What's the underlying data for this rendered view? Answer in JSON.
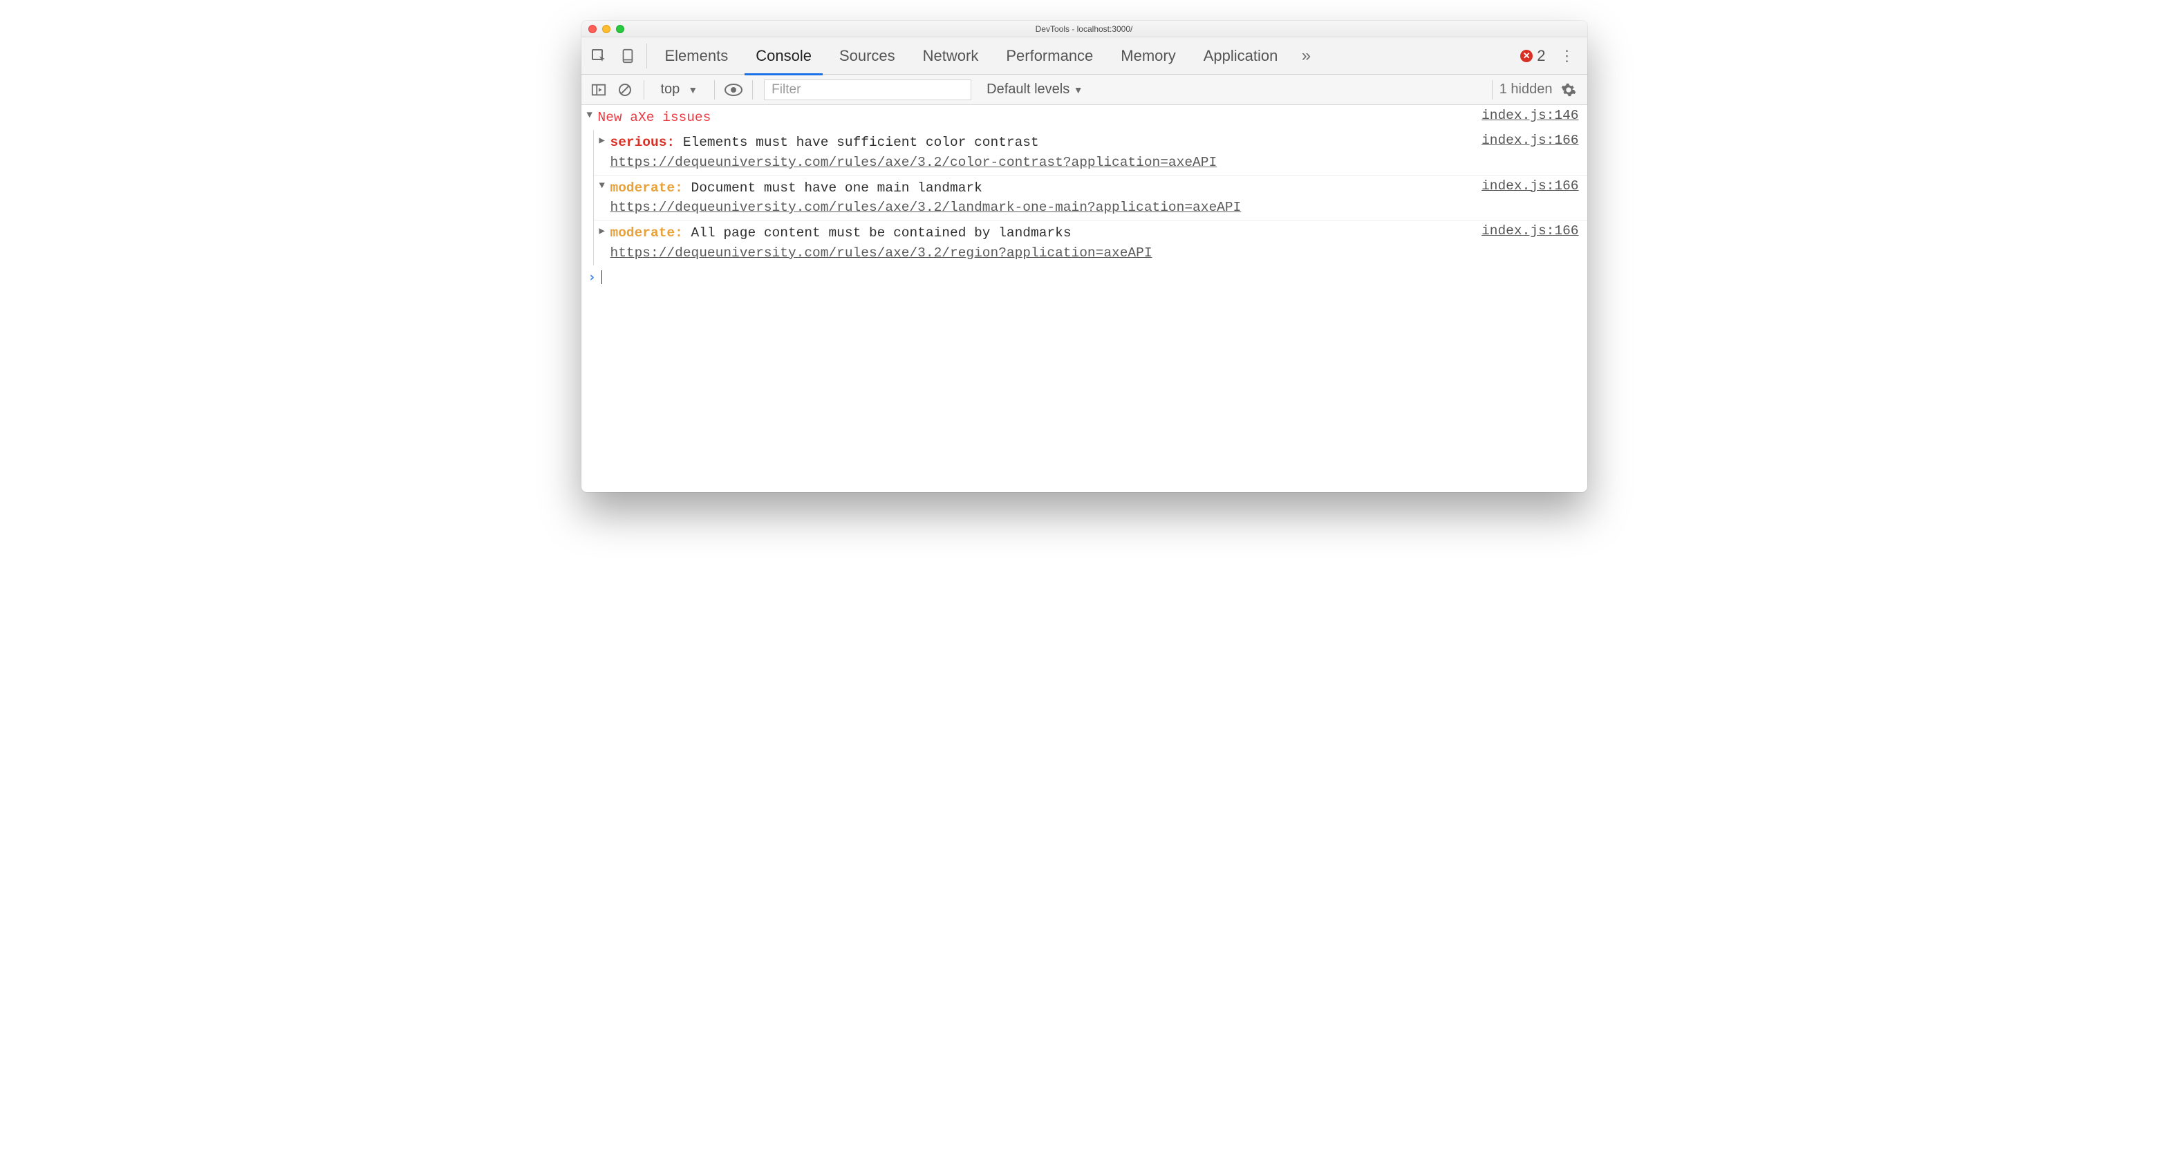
{
  "window": {
    "title": "DevTools - localhost:3000/"
  },
  "tabs": {
    "items": [
      {
        "label": "Elements"
      },
      {
        "label": "Console"
      },
      {
        "label": "Sources"
      },
      {
        "label": "Network"
      },
      {
        "label": "Performance"
      },
      {
        "label": "Memory"
      },
      {
        "label": "Application"
      }
    ],
    "active_index": 1,
    "error_count": "2"
  },
  "toolbar": {
    "context": "top",
    "filter_placeholder": "Filter",
    "levels": "Default levels",
    "hidden": "1 hidden"
  },
  "console": {
    "group_label": "New aXe issues",
    "group_source": "index.js:146",
    "entries": [
      {
        "expanded": false,
        "severity": "serious",
        "severity_text": "serious:",
        "message": "Elements must have sufficient color contrast",
        "url": "https://dequeuniversity.com/rules/axe/3.2/color-contrast?application=axeAPI",
        "source": "index.js:166"
      },
      {
        "expanded": true,
        "severity": "moderate",
        "severity_text": "moderate:",
        "message": "Document must have one main landmark",
        "url": "https://dequeuniversity.com/rules/axe/3.2/landmark-one-main?application=axeAPI",
        "source": "index.js:166"
      },
      {
        "expanded": false,
        "severity": "moderate",
        "severity_text": "moderate:",
        "message": "All page content must be contained by landmarks",
        "url": "https://dequeuniversity.com/rules/axe/3.2/region?application=axeAPI",
        "source": "index.js:166"
      }
    ]
  }
}
